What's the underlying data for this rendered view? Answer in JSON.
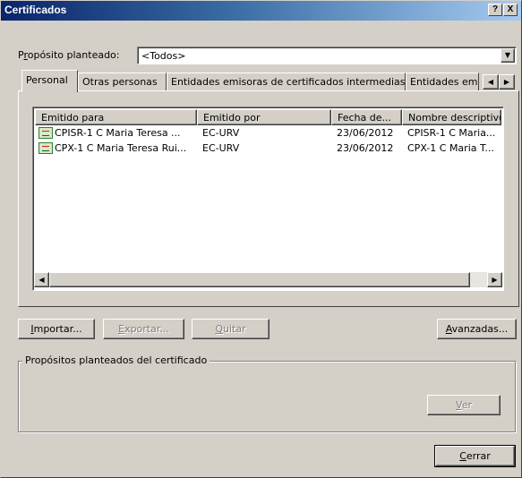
{
  "window": {
    "title": "Certificados",
    "help_glyph": "?",
    "close_glyph": "X"
  },
  "purpose": {
    "label_accel": "r",
    "label_before": "P",
    "label_after": "opósito planteado:",
    "value": "<Todos>"
  },
  "tabs": [
    {
      "label": "Personal"
    },
    {
      "label": "Otras personas"
    },
    {
      "label": "Entidades emisoras de certificados intermedias"
    },
    {
      "label": "Entidades emi"
    }
  ],
  "table": {
    "columns": [
      "Emitido para",
      "Emitido por",
      "Fecha de...",
      "Nombre descriptivo"
    ],
    "rows": [
      [
        "CPISR-1 C Maria Teresa ...",
        "EC-URV",
        "23/06/2012",
        "CPISR-1 C Maria..."
      ],
      [
        "CPX-1 C Maria Teresa Rui...",
        "EC-URV",
        "23/06/2012",
        "CPX-1 C Maria T..."
      ]
    ]
  },
  "buttons": {
    "importar": {
      "accel": "I",
      "rest": "mportar..."
    },
    "exportar": {
      "accel": "E",
      "rest": "xportar..."
    },
    "quitar": {
      "accel": "Q",
      "rest": "uitar"
    },
    "avanzadas": {
      "accel": "A",
      "rest": "vanzadas..."
    },
    "ver": {
      "accel": "V",
      "rest": "er"
    },
    "cerrar": {
      "accel": "C",
      "rest": "errar"
    }
  },
  "purposes_group": {
    "label": "Propósitos planteados del certificado"
  },
  "colors": {
    "face": "#d4d0c8",
    "title_start": "#0a246a",
    "title_end": "#a6caf0"
  }
}
